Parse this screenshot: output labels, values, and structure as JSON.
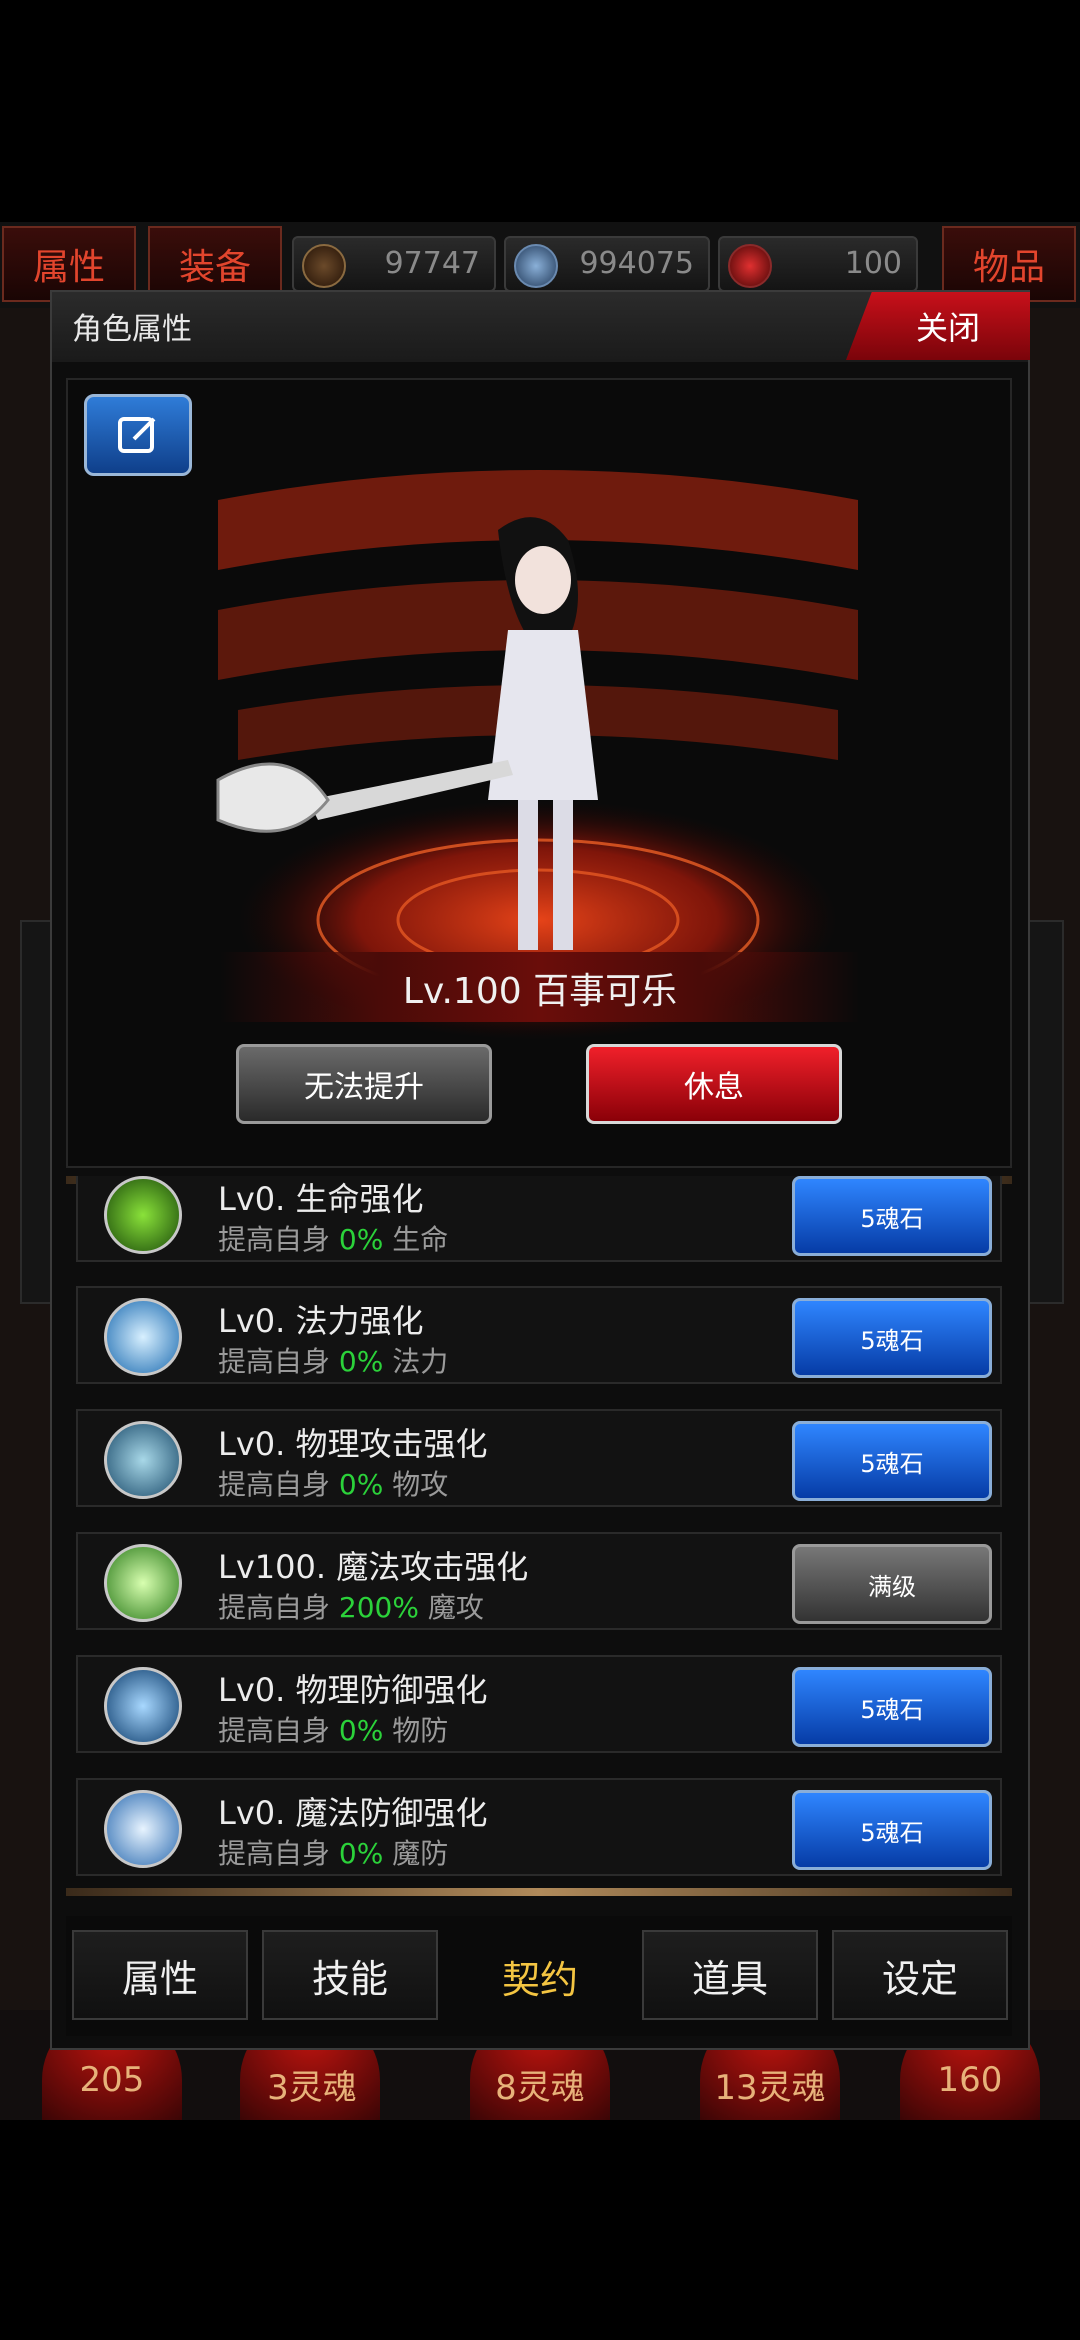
{
  "top_tabs": {
    "attributes": "属性",
    "equipment": "装备",
    "items": "物品"
  },
  "resources": [
    {
      "icon": "gold-coin-icon",
      "value": "97747"
    },
    {
      "icon": "skull-gem-icon",
      "value": "994075"
    },
    {
      "icon": "red-crystal-icon",
      "value": "100"
    }
  ],
  "dialog": {
    "title": "角色属性",
    "close_label": "关闭",
    "character_name": "Lv.100 百事可乐",
    "upgrade_label": "无法提升",
    "rest_label": "休息"
  },
  "skills": [
    {
      "name": "Lv0. 生命强化",
      "desc_prefix": "提高自身",
      "pct": "0%",
      "stat": "生命",
      "button": "5魂石",
      "button_style": "blue",
      "icon": "life-enhance-icon",
      "icon_color": "#4a9a1a"
    },
    {
      "name": "Lv0. 法力强化",
      "desc_prefix": "提高自身",
      "pct": "0%",
      "stat": "法力",
      "button": "5魂石",
      "button_style": "blue",
      "icon": "mana-enhance-icon",
      "icon_color": "#2a8ad8"
    },
    {
      "name": "Lv0. 物理攻击强化",
      "desc_prefix": "提高自身",
      "pct": "0%",
      "stat": "物攻",
      "button": "5魂石",
      "button_style": "blue",
      "icon": "physical-attack-icon",
      "icon_color": "#3a8ab0"
    },
    {
      "name": "Lv100. 魔法攻击强化",
      "desc_prefix": "提高自身",
      "pct": "200%",
      "stat": "魔攻",
      "button": "满级",
      "button_style": "gray",
      "icon": "magic-attack-icon",
      "icon_color": "#3aa82a"
    },
    {
      "name": "Lv0. 物理防御强化",
      "desc_prefix": "提高自身",
      "pct": "0%",
      "stat": "物防",
      "button": "5魂石",
      "button_style": "blue",
      "icon": "physical-defense-icon",
      "icon_color": "#1a6aa8"
    },
    {
      "name": "Lv0. 魔法防御强化",
      "desc_prefix": "提高自身",
      "pct": "0%",
      "stat": "魔防",
      "button": "5魂石",
      "button_style": "blue",
      "icon": "magic-defense-icon",
      "icon_color": "#2a7ac8"
    }
  ],
  "tabs": [
    {
      "label": "属性",
      "active": false
    },
    {
      "label": "技能",
      "active": false
    },
    {
      "label": "契约",
      "active": true
    },
    {
      "label": "道具",
      "active": false
    },
    {
      "label": "设定",
      "active": false
    }
  ],
  "bottom_bar": [
    "205",
    "3灵魂",
    "8灵魂",
    "13灵魂",
    "160"
  ],
  "colors": {
    "accent_red": "#c8101a",
    "highlight_gold": "#f4c542",
    "percent_green": "#2bd23a"
  }
}
